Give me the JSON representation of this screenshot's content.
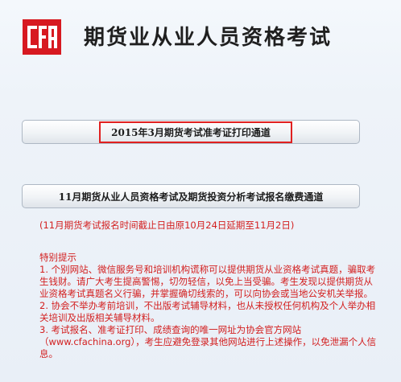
{
  "header": {
    "logo_text": "CFA",
    "site_title": "期货业从业人员资格考试"
  },
  "buttons": {
    "admission_ticket": "2015年3月期货考试准考证打印通道",
    "registration": "11月期货从业人员资格考试及期货投资分析考试报名缴费通道"
  },
  "deadline_note": "(11月期货考试报名时间截止日由原10月24日延期至11月2日)",
  "notice": {
    "title": "特别提示",
    "items": [
      "1. 个别网站、微信服务号和培训机构谎称可以提供期货从业资格考试真题，骗取考生钱财。请广大考生提高警惕，切勿轻信，以免上当受骗。考生发现以提供期货从业资格考试真题名义行骗，并掌握确切线索的，可以向协会或当地公安机关举报。",
      "2. 协会不举办考前培训，不出版考试辅导材料，也从未授权任何机构及个人举办相关培训及出版相关辅导材料。",
      "3. 考试报名、准考证打印、成绩查询的唯一网址为协会官方网站（www.cfachina.org），考生应避免登录其他网站进行上述操作，以免泄漏个人信息。"
    ]
  },
  "colors": {
    "brand_red": "#d71920",
    "notice_red": "#d32020"
  }
}
